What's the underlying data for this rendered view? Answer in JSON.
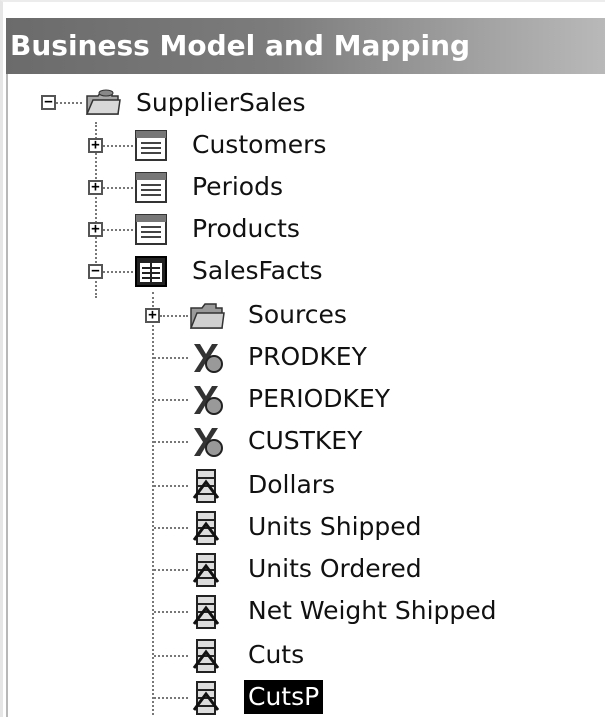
{
  "panel": {
    "title": "Business Model and Mapping"
  },
  "tree": {
    "root": {
      "label": "SupplierSales",
      "icon": "folder-database-icon",
      "expander": "−"
    },
    "tables": [
      {
        "label": "Customers",
        "icon": "table-icon",
        "expander": "+"
      },
      {
        "label": "Periods",
        "icon": "table-icon",
        "expander": "+"
      },
      {
        "label": "Products",
        "icon": "table-icon",
        "expander": "+"
      },
      {
        "label": "SalesFacts",
        "icon": "fact-table-icon",
        "expander": "−"
      }
    ],
    "sales_facts_children": [
      {
        "label": "Sources",
        "icon": "folder-icon",
        "expander": "+"
      },
      {
        "label": "PRODKEY",
        "icon": "key-column-icon"
      },
      {
        "label": "PERIODKEY",
        "icon": "key-column-icon"
      },
      {
        "label": "CUSTKEY",
        "icon": "key-column-icon"
      },
      {
        "label": "Dollars",
        "icon": "measure-column-icon"
      },
      {
        "label": "Units Shipped",
        "icon": "measure-column-icon"
      },
      {
        "label": "Units Ordered",
        "icon": "measure-column-icon"
      },
      {
        "label": "Net Weight Shipped",
        "icon": "measure-column-icon"
      },
      {
        "label": "Cuts",
        "icon": "measure-column-icon"
      },
      {
        "label": "CutsP",
        "icon": "measure-column-icon",
        "selected": true
      }
    ]
  }
}
